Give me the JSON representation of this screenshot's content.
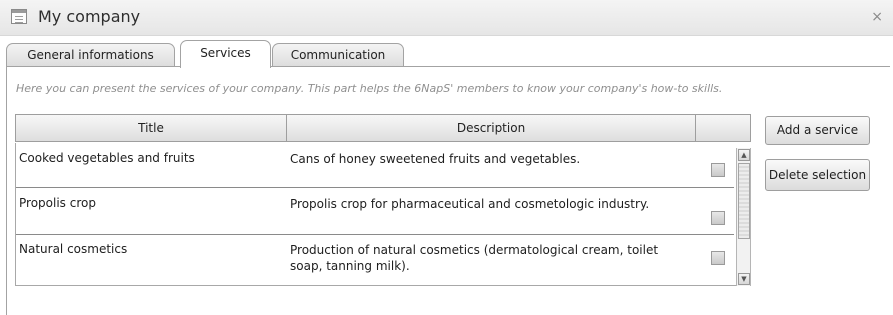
{
  "window": {
    "title": "My company",
    "close_glyph": "×",
    "icon": "window-icon"
  },
  "tabs": [
    {
      "label": "General informations",
      "active": false
    },
    {
      "label": "Services",
      "active": true
    },
    {
      "label": "Communication",
      "active": false
    }
  ],
  "intro_text": "Here you can present the services of your company. This part helps the 6NapS' members to know your company's how-to skills.",
  "table": {
    "columns": [
      "Title",
      "Description",
      ""
    ],
    "rows": [
      {
        "title": "Cooked vegetables and fruits",
        "description": "Cans of honey sweetened fruits and vegetables.",
        "selected": false
      },
      {
        "title": "Propolis crop",
        "description": "Propolis crop for pharmaceutical and cosmetologic industry.",
        "selected": false
      },
      {
        "title": "Natural cosmetics",
        "description": "Production of natural cosmetics (dermatological cream, toilet soap, tanning milk).",
        "selected": false
      }
    ]
  },
  "buttons": {
    "add": "Add a service",
    "delete": "Delete selection"
  },
  "scrollbar": {
    "up_glyph": "▲",
    "down_glyph": "▼"
  }
}
